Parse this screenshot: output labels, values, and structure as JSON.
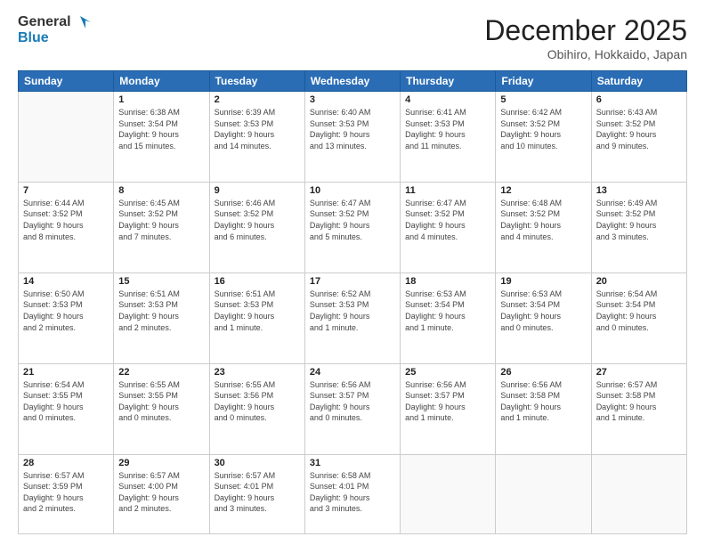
{
  "header": {
    "logo_line1": "General",
    "logo_line2": "Blue",
    "month": "December 2025",
    "location": "Obihiro, Hokkaido, Japan"
  },
  "weekdays": [
    "Sunday",
    "Monday",
    "Tuesday",
    "Wednesday",
    "Thursday",
    "Friday",
    "Saturday"
  ],
  "weeks": [
    [
      {
        "day": "",
        "info": ""
      },
      {
        "day": "1",
        "info": "Sunrise: 6:38 AM\nSunset: 3:54 PM\nDaylight: 9 hours\nand 15 minutes."
      },
      {
        "day": "2",
        "info": "Sunrise: 6:39 AM\nSunset: 3:53 PM\nDaylight: 9 hours\nand 14 minutes."
      },
      {
        "day": "3",
        "info": "Sunrise: 6:40 AM\nSunset: 3:53 PM\nDaylight: 9 hours\nand 13 minutes."
      },
      {
        "day": "4",
        "info": "Sunrise: 6:41 AM\nSunset: 3:53 PM\nDaylight: 9 hours\nand 11 minutes."
      },
      {
        "day": "5",
        "info": "Sunrise: 6:42 AM\nSunset: 3:52 PM\nDaylight: 9 hours\nand 10 minutes."
      },
      {
        "day": "6",
        "info": "Sunrise: 6:43 AM\nSunset: 3:52 PM\nDaylight: 9 hours\nand 9 minutes."
      }
    ],
    [
      {
        "day": "7",
        "info": "Sunrise: 6:44 AM\nSunset: 3:52 PM\nDaylight: 9 hours\nand 8 minutes."
      },
      {
        "day": "8",
        "info": "Sunrise: 6:45 AM\nSunset: 3:52 PM\nDaylight: 9 hours\nand 7 minutes."
      },
      {
        "day": "9",
        "info": "Sunrise: 6:46 AM\nSunset: 3:52 PM\nDaylight: 9 hours\nand 6 minutes."
      },
      {
        "day": "10",
        "info": "Sunrise: 6:47 AM\nSunset: 3:52 PM\nDaylight: 9 hours\nand 5 minutes."
      },
      {
        "day": "11",
        "info": "Sunrise: 6:47 AM\nSunset: 3:52 PM\nDaylight: 9 hours\nand 4 minutes."
      },
      {
        "day": "12",
        "info": "Sunrise: 6:48 AM\nSunset: 3:52 PM\nDaylight: 9 hours\nand 4 minutes."
      },
      {
        "day": "13",
        "info": "Sunrise: 6:49 AM\nSunset: 3:52 PM\nDaylight: 9 hours\nand 3 minutes."
      }
    ],
    [
      {
        "day": "14",
        "info": "Sunrise: 6:50 AM\nSunset: 3:53 PM\nDaylight: 9 hours\nand 2 minutes."
      },
      {
        "day": "15",
        "info": "Sunrise: 6:51 AM\nSunset: 3:53 PM\nDaylight: 9 hours\nand 2 minutes."
      },
      {
        "day": "16",
        "info": "Sunrise: 6:51 AM\nSunset: 3:53 PM\nDaylight: 9 hours\nand 1 minute."
      },
      {
        "day": "17",
        "info": "Sunrise: 6:52 AM\nSunset: 3:53 PM\nDaylight: 9 hours\nand 1 minute."
      },
      {
        "day": "18",
        "info": "Sunrise: 6:53 AM\nSunset: 3:54 PM\nDaylight: 9 hours\nand 1 minute."
      },
      {
        "day": "19",
        "info": "Sunrise: 6:53 AM\nSunset: 3:54 PM\nDaylight: 9 hours\nand 0 minutes."
      },
      {
        "day": "20",
        "info": "Sunrise: 6:54 AM\nSunset: 3:54 PM\nDaylight: 9 hours\nand 0 minutes."
      }
    ],
    [
      {
        "day": "21",
        "info": "Sunrise: 6:54 AM\nSunset: 3:55 PM\nDaylight: 9 hours\nand 0 minutes."
      },
      {
        "day": "22",
        "info": "Sunrise: 6:55 AM\nSunset: 3:55 PM\nDaylight: 9 hours\nand 0 minutes."
      },
      {
        "day": "23",
        "info": "Sunrise: 6:55 AM\nSunset: 3:56 PM\nDaylight: 9 hours\nand 0 minutes."
      },
      {
        "day": "24",
        "info": "Sunrise: 6:56 AM\nSunset: 3:57 PM\nDaylight: 9 hours\nand 0 minutes."
      },
      {
        "day": "25",
        "info": "Sunrise: 6:56 AM\nSunset: 3:57 PM\nDaylight: 9 hours\nand 1 minute."
      },
      {
        "day": "26",
        "info": "Sunrise: 6:56 AM\nSunset: 3:58 PM\nDaylight: 9 hours\nand 1 minute."
      },
      {
        "day": "27",
        "info": "Sunrise: 6:57 AM\nSunset: 3:58 PM\nDaylight: 9 hours\nand 1 minute."
      }
    ],
    [
      {
        "day": "28",
        "info": "Sunrise: 6:57 AM\nSunset: 3:59 PM\nDaylight: 9 hours\nand 2 minutes."
      },
      {
        "day": "29",
        "info": "Sunrise: 6:57 AM\nSunset: 4:00 PM\nDaylight: 9 hours\nand 2 minutes."
      },
      {
        "day": "30",
        "info": "Sunrise: 6:57 AM\nSunset: 4:01 PM\nDaylight: 9 hours\nand 3 minutes."
      },
      {
        "day": "31",
        "info": "Sunrise: 6:58 AM\nSunset: 4:01 PM\nDaylight: 9 hours\nand 3 minutes."
      },
      {
        "day": "",
        "info": ""
      },
      {
        "day": "",
        "info": ""
      },
      {
        "day": "",
        "info": ""
      }
    ]
  ]
}
